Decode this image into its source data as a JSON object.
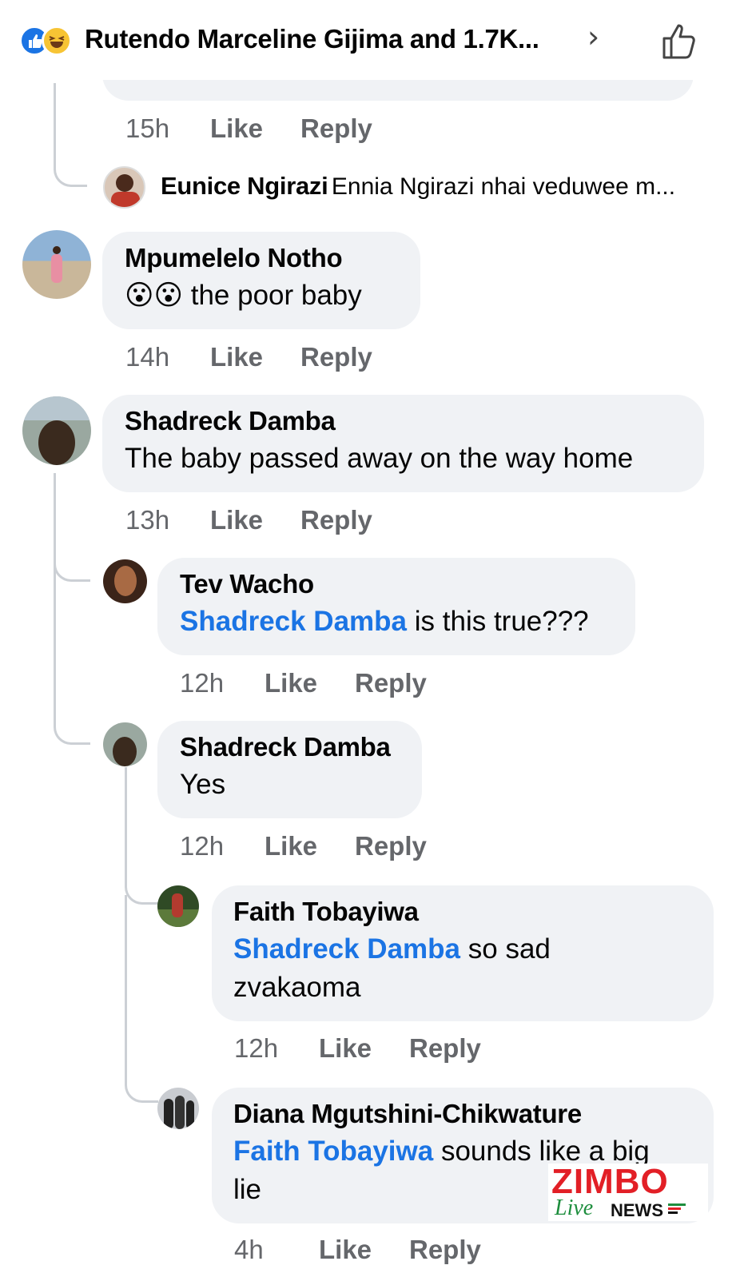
{
  "header": {
    "title": "Rutendo Marceline Gijima and 1.7K...",
    "reaction_icons": [
      "like-icon",
      "haha-icon"
    ],
    "chevron": "›",
    "like_button_icon": "thumbs-up-outline-icon"
  },
  "comments": [
    {
      "time": "15h",
      "like": "Like",
      "reply": "Reply"
    },
    {
      "name": "Eunice Ngirazi",
      "text": "Ennia Ngirazi nhai veduwee m..."
    },
    {
      "name": "Mpumelelo Notho",
      "emoji": "😮😮",
      "text": "the poor baby",
      "time": "14h",
      "like": "Like",
      "reply": "Reply"
    },
    {
      "name": "Shadreck Damba",
      "text": "The baby passed away on the way home",
      "time": "13h",
      "like": "Like",
      "reply": "Reply"
    },
    {
      "name": "Tev Wacho",
      "mention": "Shadreck Damba",
      "text": " is this true???",
      "time": "12h",
      "like": "Like",
      "reply": "Reply"
    },
    {
      "name": "Shadreck Damba",
      "text": "Yes",
      "time": "12h",
      "like": "Like",
      "reply": "Reply"
    },
    {
      "name": "Faith Tobayiwa",
      "mention": "Shadreck Damba",
      "text": " so sad",
      "text2": "zvakaoma",
      "time": "12h",
      "like": "Like",
      "reply": "Reply"
    },
    {
      "name": "Diana Mgutshini-Chikwature",
      "mention": "Faith Tobayiwa",
      "text": " sounds like a big",
      "text2": "lie",
      "time": "4h",
      "like": "Like",
      "reply": "Reply"
    }
  ],
  "watermark": {
    "zimbo": "ZIMBO",
    "live": "Live",
    "news": "NEWS"
  },
  "colors": {
    "mention": "#1b74e4",
    "bubble": "#f0f2f5",
    "meta": "#65676b",
    "watermark_red": "#e21f26",
    "watermark_green": "#1e8e3e"
  }
}
